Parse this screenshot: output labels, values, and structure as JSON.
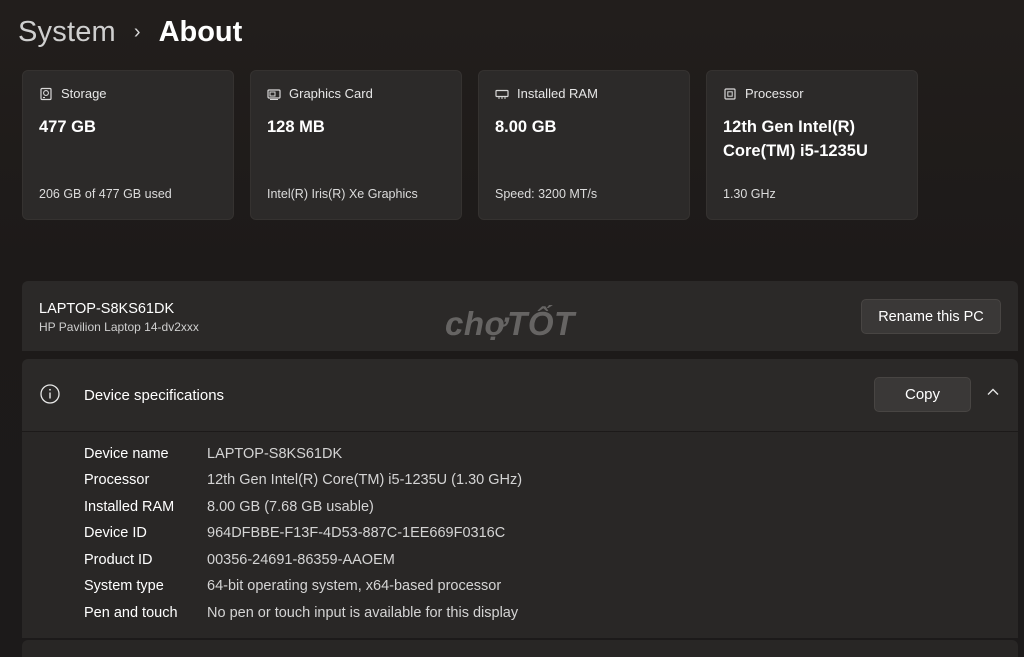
{
  "breadcrumb": {
    "parent": "System",
    "separator": "›",
    "current": "About"
  },
  "cards": [
    {
      "icon": "storage-icon",
      "label": "Storage",
      "value": "477 GB",
      "detail": "206 GB of 477 GB used"
    },
    {
      "icon": "graphics-card-icon",
      "label": "Graphics Card",
      "value": "128 MB",
      "detail": "Intel(R) Iris(R) Xe Graphics"
    },
    {
      "icon": "ram-icon",
      "label": "Installed RAM",
      "value": "8.00 GB",
      "detail": "Speed: 3200 MT/s"
    },
    {
      "icon": "processor-icon",
      "label": "Processor",
      "value": "12th Gen Intel(R) Core(TM) i5-1235U",
      "detail": "1.30 GHz"
    }
  ],
  "pc": {
    "name": "LAPTOP-S8KS61DK",
    "model": "HP Pavilion Laptop 14-dv2xxx",
    "rename_label": "Rename this PC"
  },
  "watermark": "chợTỐT",
  "specs": {
    "title": "Device specifications",
    "copy_label": "Copy",
    "rows": [
      {
        "key": "Device name",
        "value": "LAPTOP-S8KS61DK"
      },
      {
        "key": "Processor",
        "value": "12th Gen Intel(R) Core(TM) i5-1235U (1.30 GHz)"
      },
      {
        "key": "Installed RAM",
        "value": "8.00 GB (7.68 GB usable)"
      },
      {
        "key": "Device ID",
        "value": "964DFBBE-F13F-4D53-887C-1EE669F0316C"
      },
      {
        "key": "Product ID",
        "value": "00356-24691-86359-AAOEM"
      },
      {
        "key": "System type",
        "value": "64-bit operating system, x64-based processor"
      },
      {
        "key": "Pen and touch",
        "value": "No pen or touch input is available for this display"
      }
    ]
  },
  "colors": {
    "background": "#1f1c1b",
    "card": "#2c2a29",
    "button": "#3a3837"
  }
}
